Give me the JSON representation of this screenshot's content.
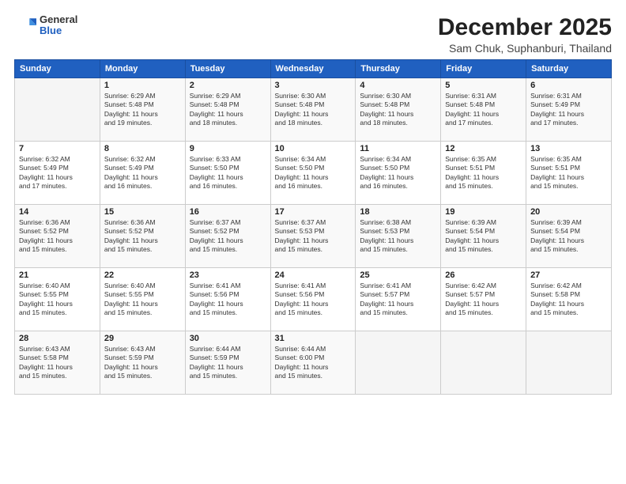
{
  "header": {
    "logo_general": "General",
    "logo_blue": "Blue",
    "title": "December 2025",
    "subtitle": "Sam Chuk, Suphanburi, Thailand"
  },
  "calendar": {
    "days_of_week": [
      "Sunday",
      "Monday",
      "Tuesday",
      "Wednesday",
      "Thursday",
      "Friday",
      "Saturday"
    ],
    "weeks": [
      [
        {
          "day": "",
          "detail": ""
        },
        {
          "day": "1",
          "detail": "Sunrise: 6:29 AM\nSunset: 5:48 PM\nDaylight: 11 hours\nand 19 minutes."
        },
        {
          "day": "2",
          "detail": "Sunrise: 6:29 AM\nSunset: 5:48 PM\nDaylight: 11 hours\nand 18 minutes."
        },
        {
          "day": "3",
          "detail": "Sunrise: 6:30 AM\nSunset: 5:48 PM\nDaylight: 11 hours\nand 18 minutes."
        },
        {
          "day": "4",
          "detail": "Sunrise: 6:30 AM\nSunset: 5:48 PM\nDaylight: 11 hours\nand 18 minutes."
        },
        {
          "day": "5",
          "detail": "Sunrise: 6:31 AM\nSunset: 5:48 PM\nDaylight: 11 hours\nand 17 minutes."
        },
        {
          "day": "6",
          "detail": "Sunrise: 6:31 AM\nSunset: 5:49 PM\nDaylight: 11 hours\nand 17 minutes."
        }
      ],
      [
        {
          "day": "7",
          "detail": "Sunrise: 6:32 AM\nSunset: 5:49 PM\nDaylight: 11 hours\nand 17 minutes."
        },
        {
          "day": "8",
          "detail": "Sunrise: 6:32 AM\nSunset: 5:49 PM\nDaylight: 11 hours\nand 16 minutes."
        },
        {
          "day": "9",
          "detail": "Sunrise: 6:33 AM\nSunset: 5:50 PM\nDaylight: 11 hours\nand 16 minutes."
        },
        {
          "day": "10",
          "detail": "Sunrise: 6:34 AM\nSunset: 5:50 PM\nDaylight: 11 hours\nand 16 minutes."
        },
        {
          "day": "11",
          "detail": "Sunrise: 6:34 AM\nSunset: 5:50 PM\nDaylight: 11 hours\nand 16 minutes."
        },
        {
          "day": "12",
          "detail": "Sunrise: 6:35 AM\nSunset: 5:51 PM\nDaylight: 11 hours\nand 15 minutes."
        },
        {
          "day": "13",
          "detail": "Sunrise: 6:35 AM\nSunset: 5:51 PM\nDaylight: 11 hours\nand 15 minutes."
        }
      ],
      [
        {
          "day": "14",
          "detail": "Sunrise: 6:36 AM\nSunset: 5:52 PM\nDaylight: 11 hours\nand 15 minutes."
        },
        {
          "day": "15",
          "detail": "Sunrise: 6:36 AM\nSunset: 5:52 PM\nDaylight: 11 hours\nand 15 minutes."
        },
        {
          "day": "16",
          "detail": "Sunrise: 6:37 AM\nSunset: 5:52 PM\nDaylight: 11 hours\nand 15 minutes."
        },
        {
          "day": "17",
          "detail": "Sunrise: 6:37 AM\nSunset: 5:53 PM\nDaylight: 11 hours\nand 15 minutes."
        },
        {
          "day": "18",
          "detail": "Sunrise: 6:38 AM\nSunset: 5:53 PM\nDaylight: 11 hours\nand 15 minutes."
        },
        {
          "day": "19",
          "detail": "Sunrise: 6:39 AM\nSunset: 5:54 PM\nDaylight: 11 hours\nand 15 minutes."
        },
        {
          "day": "20",
          "detail": "Sunrise: 6:39 AM\nSunset: 5:54 PM\nDaylight: 11 hours\nand 15 minutes."
        }
      ],
      [
        {
          "day": "21",
          "detail": "Sunrise: 6:40 AM\nSunset: 5:55 PM\nDaylight: 11 hours\nand 15 minutes."
        },
        {
          "day": "22",
          "detail": "Sunrise: 6:40 AM\nSunset: 5:55 PM\nDaylight: 11 hours\nand 15 minutes."
        },
        {
          "day": "23",
          "detail": "Sunrise: 6:41 AM\nSunset: 5:56 PM\nDaylight: 11 hours\nand 15 minutes."
        },
        {
          "day": "24",
          "detail": "Sunrise: 6:41 AM\nSunset: 5:56 PM\nDaylight: 11 hours\nand 15 minutes."
        },
        {
          "day": "25",
          "detail": "Sunrise: 6:41 AM\nSunset: 5:57 PM\nDaylight: 11 hours\nand 15 minutes."
        },
        {
          "day": "26",
          "detail": "Sunrise: 6:42 AM\nSunset: 5:57 PM\nDaylight: 11 hours\nand 15 minutes."
        },
        {
          "day": "27",
          "detail": "Sunrise: 6:42 AM\nSunset: 5:58 PM\nDaylight: 11 hours\nand 15 minutes."
        }
      ],
      [
        {
          "day": "28",
          "detail": "Sunrise: 6:43 AM\nSunset: 5:58 PM\nDaylight: 11 hours\nand 15 minutes."
        },
        {
          "day": "29",
          "detail": "Sunrise: 6:43 AM\nSunset: 5:59 PM\nDaylight: 11 hours\nand 15 minutes."
        },
        {
          "day": "30",
          "detail": "Sunrise: 6:44 AM\nSunset: 5:59 PM\nDaylight: 11 hours\nand 15 minutes."
        },
        {
          "day": "31",
          "detail": "Sunrise: 6:44 AM\nSunset: 6:00 PM\nDaylight: 11 hours\nand 15 minutes."
        },
        {
          "day": "",
          "detail": ""
        },
        {
          "day": "",
          "detail": ""
        },
        {
          "day": "",
          "detail": ""
        }
      ]
    ]
  }
}
